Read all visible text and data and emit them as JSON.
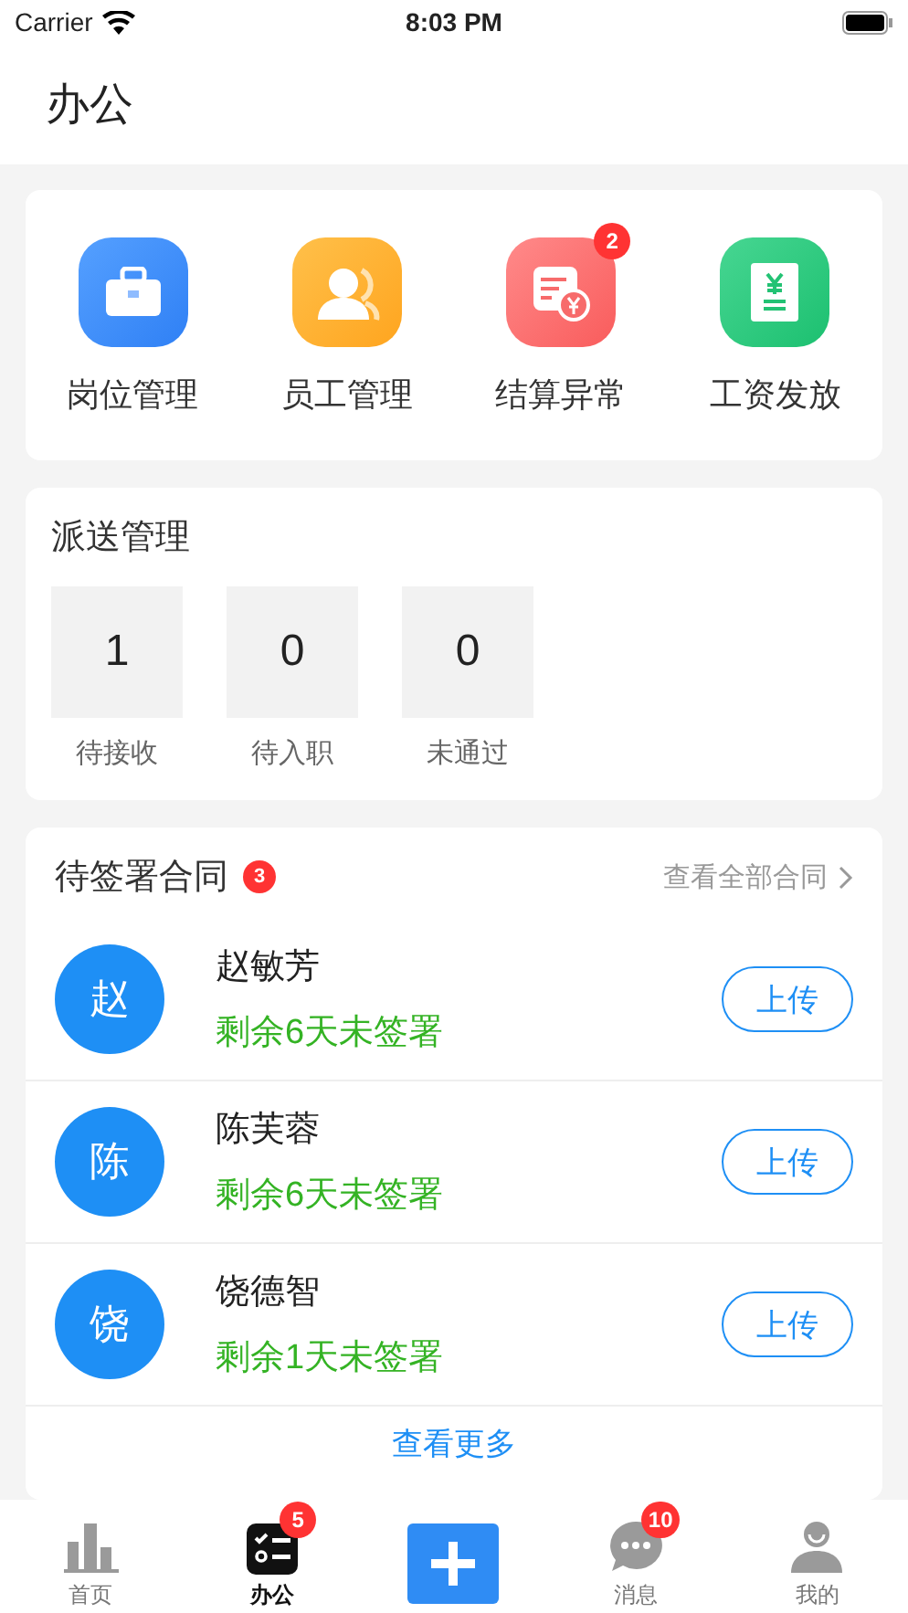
{
  "status_bar": {
    "carrier": "Carrier",
    "time": "8:03 PM"
  },
  "header": {
    "title": "办公"
  },
  "shortcuts": [
    {
      "kind": "briefcase",
      "label": "岗位管理"
    },
    {
      "kind": "people",
      "label": "员工管理"
    },
    {
      "kind": "bill",
      "label": "结算异常",
      "badge": "2"
    },
    {
      "kind": "salary",
      "label": "工资发放"
    }
  ],
  "dispatch": {
    "title": "派送管理",
    "stats": [
      {
        "value": "1",
        "label": "待接收"
      },
      {
        "value": "0",
        "label": "待入职"
      },
      {
        "value": "0",
        "label": "未通过"
      }
    ]
  },
  "contracts": {
    "title": "待签署合同",
    "badge": "3",
    "link": "查看全部合同",
    "more": "查看更多",
    "rows": [
      {
        "avatar": "赵",
        "name": "赵敏芳",
        "status": "剩余6天未签署",
        "action": "上传"
      },
      {
        "avatar": "陈",
        "name": "陈芙蓉",
        "status": "剩余6天未签署",
        "action": "上传"
      },
      {
        "avatar": "饶",
        "name": "饶德智",
        "status": "剩余1天未签署",
        "action": "上传"
      }
    ]
  },
  "tab_bar": [
    {
      "kind": "chart",
      "label": "首页",
      "selected": false
    },
    {
      "kind": "tasks",
      "label": "办公",
      "selected": true,
      "badge": "5"
    },
    {
      "kind": "add"
    },
    {
      "kind": "chat",
      "label": "消息",
      "selected": false,
      "badge": "10"
    },
    {
      "kind": "person",
      "label": "我的",
      "selected": false
    }
  ]
}
